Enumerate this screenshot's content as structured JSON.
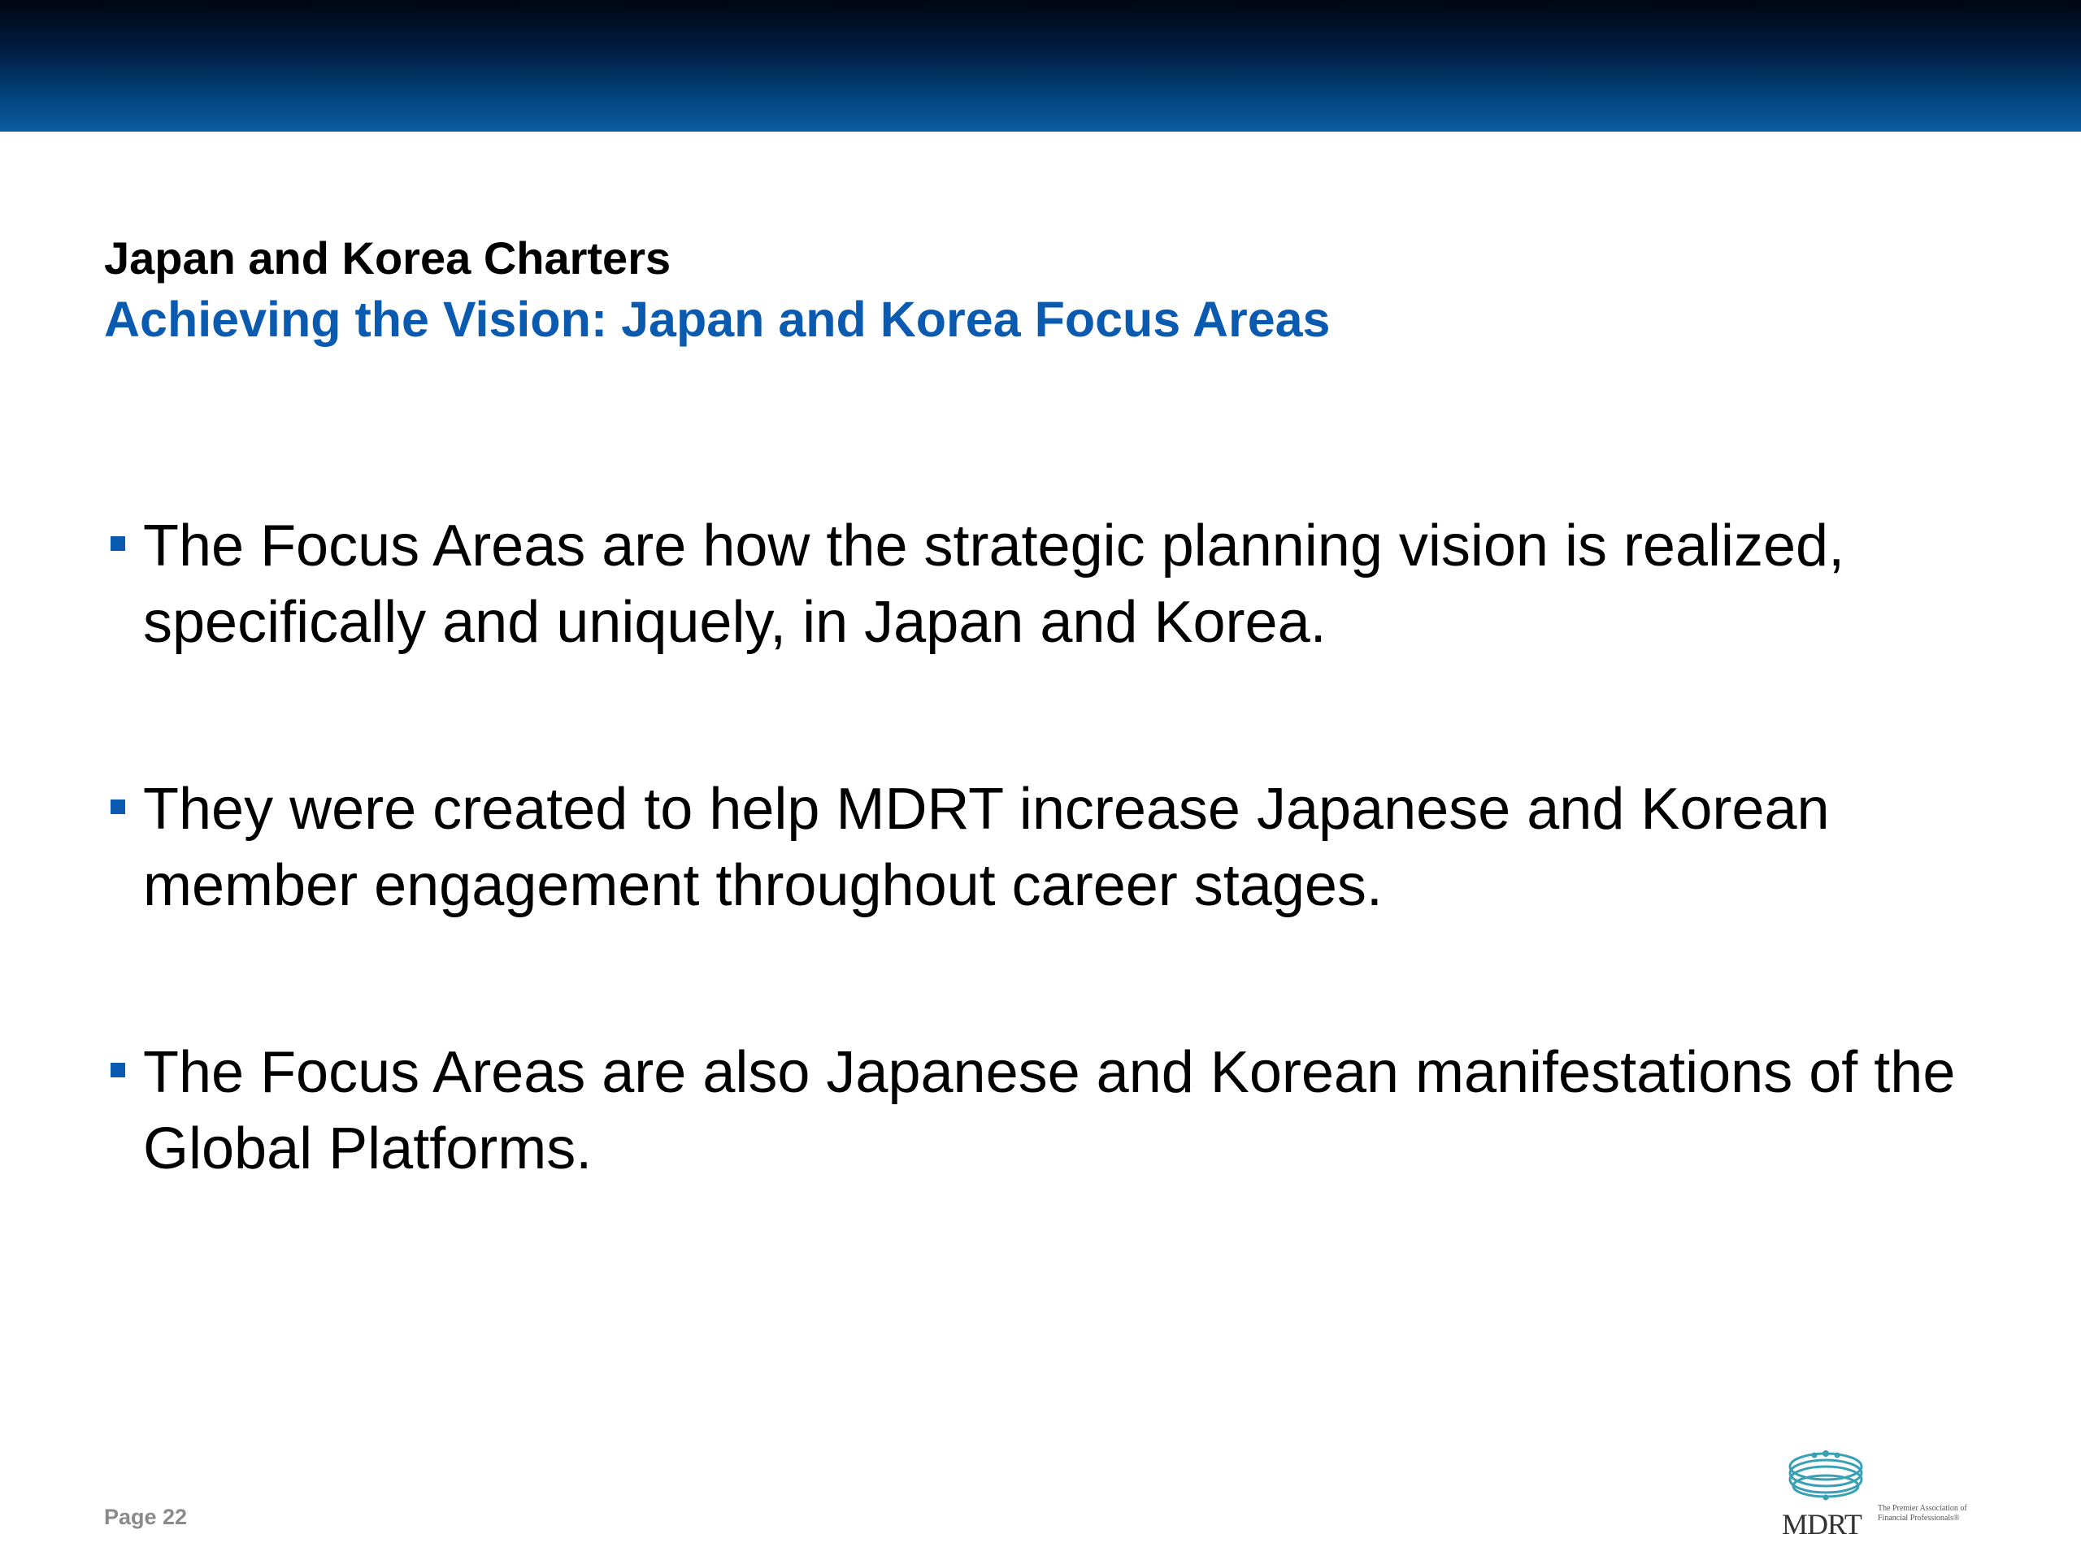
{
  "header": {
    "title": "Japan and Korea Charters",
    "subtitle": "Achieving the Vision: Japan and Korea Focus Areas"
  },
  "bullets": [
    "The Focus Areas are how the strategic planning vision is realized, specifically and uniquely, in Japan and Korea.",
    "They were created to help MDRT increase Japanese and Korean member engagement throughout career stages.",
    "The Focus Areas are also Japanese and Korean manifestations of the Global Platforms."
  ],
  "footer": {
    "page_label": "Page 22",
    "logo_text": "MDRT",
    "logo_tagline": "The Premier Association of Financial Professionals®"
  },
  "colors": {
    "accent": "#0a5bb0",
    "band_dark": "#000612",
    "band_light": "#0a5ea2",
    "logo_ring": "#3aa0b4"
  },
  "icons": {
    "bullet": "square-bullet-icon",
    "logo": "mdrt-ring-logo-icon"
  }
}
